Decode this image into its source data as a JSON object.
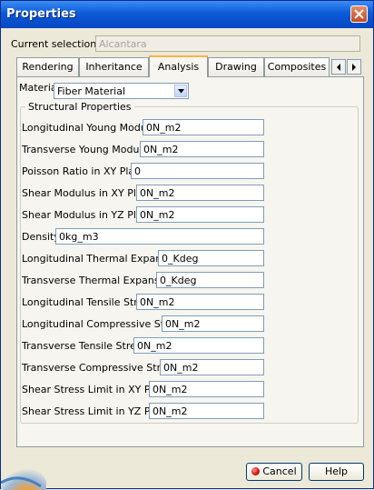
{
  "window": {
    "title": "Properties"
  },
  "selection": {
    "label": "Current selection :",
    "value": "Alcantara"
  },
  "tabs": [
    {
      "label": "Rendering"
    },
    {
      "label": "Inheritance"
    },
    {
      "label": "Analysis",
      "active": true
    },
    {
      "label": "Drawing"
    },
    {
      "label": "Composites"
    }
  ],
  "material": {
    "label": "Material",
    "value": "Fiber Material"
  },
  "group": {
    "title": "Structural Properties"
  },
  "properties": [
    {
      "label": "Longitudinal Young Modulus",
      "value": "0N_m2"
    },
    {
      "label": "Transverse Young Modulus",
      "value": "0N_m2"
    },
    {
      "label": "Poisson Ratio in XY Plane",
      "value": "0"
    },
    {
      "label": "Shear Modulus in XY Plane",
      "value": "0N_m2"
    },
    {
      "label": "Shear Modulus in YZ Plane",
      "value": "0N_m2"
    },
    {
      "label": "Density",
      "value": "0kg_m3"
    },
    {
      "label": "Longitudinal Thermal Expansion",
      "value": "0_Kdeg"
    },
    {
      "label": "Transverse Thermal Expansion",
      "value": "0_Kdeg"
    },
    {
      "label": "Longitudinal Tensile Stress",
      "value": "0N_m2"
    },
    {
      "label": "Longitudinal Compressive Stress",
      "value": "0N_m2"
    },
    {
      "label": "Transverse Tensile Stress",
      "value": "0N_m2"
    },
    {
      "label": "Transverse Compressive Stress",
      "value": "0N_m2"
    },
    {
      "label": "Shear Stress Limit in XY Plane",
      "value": "0N_m2"
    },
    {
      "label": "Shear Stress Limit in YZ Plane",
      "value": "0N_m2"
    }
  ],
  "buttons": {
    "cancel": "Cancel",
    "help": "Help"
  },
  "icons": {
    "close": "close-icon",
    "scroll_left": "arrow-left-icon",
    "scroll_right": "arrow-right-icon",
    "dropdown": "chevron-down-icon",
    "cancel": "stop-icon"
  }
}
